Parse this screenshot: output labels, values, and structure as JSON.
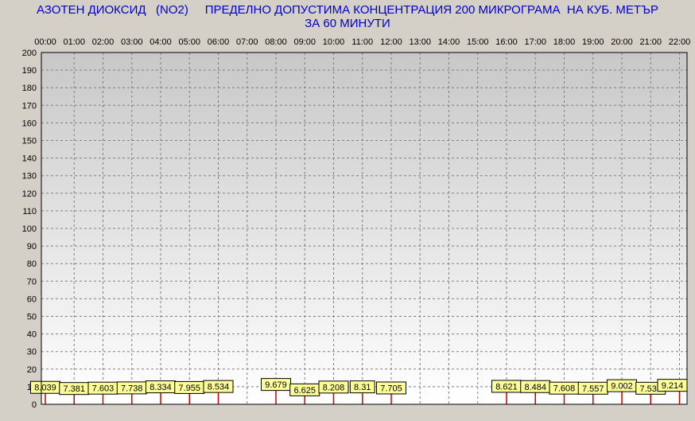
{
  "chart_data": {
    "type": "bar",
    "title": "АЗОТЕН ДИОКСИД   (NO2)     ПРЕДЕЛНО ДОПУСТИМА КОНЦЕНТРАЦИЯ 200 МИКРОГРАМА  НА КУБ. МЕТЪР\nЗА 60 МИНУТИ",
    "xlabel": "",
    "ylabel": "",
    "ylim": [
      0,
      200
    ],
    "y_ticks": [
      0,
      10,
      20,
      30,
      40,
      50,
      60,
      70,
      80,
      90,
      100,
      110,
      120,
      130,
      140,
      150,
      160,
      170,
      180,
      190,
      200
    ],
    "grid": true,
    "categories": [
      "00:00",
      "01:00",
      "02:00",
      "03:00",
      "04:00",
      "05:00",
      "06:00",
      "07:00",
      "08:00",
      "09:00",
      "10:00",
      "11:00",
      "12:00",
      "13:00",
      "14:00",
      "15:00",
      "16:00",
      "17:00",
      "18:00",
      "19:00",
      "20:00",
      "21:00",
      "22:00"
    ],
    "values": [
      8.039,
      7.381,
      7.603,
      7.738,
      8.334,
      7.955,
      8.534,
      null,
      9.679,
      6.625,
      8.208,
      8.31,
      7.705,
      null,
      null,
      null,
      8.621,
      8.484,
      7.608,
      7.557,
      9.002,
      7.537,
      9.214
    ],
    "data_labels": [
      "8.039",
      "7.381",
      "7.603",
      "7.738",
      "8.334",
      "7.955",
      "8.534",
      "",
      "9.679",
      "6.625",
      "8.208",
      "8.31",
      "7.705",
      "",
      "",
      "",
      "8.621",
      "8.484",
      "7.608",
      "7.557",
      "9.002",
      "7.537",
      "9.214"
    ],
    "colors": {
      "background": "#d4d0c8",
      "plot_top": "#c8c8c8",
      "plot_bottom": "#ffffff",
      "title": "#0000cc",
      "bar": "#cc0000",
      "label_fill": "#ffff99",
      "grid": "#808080"
    }
  }
}
